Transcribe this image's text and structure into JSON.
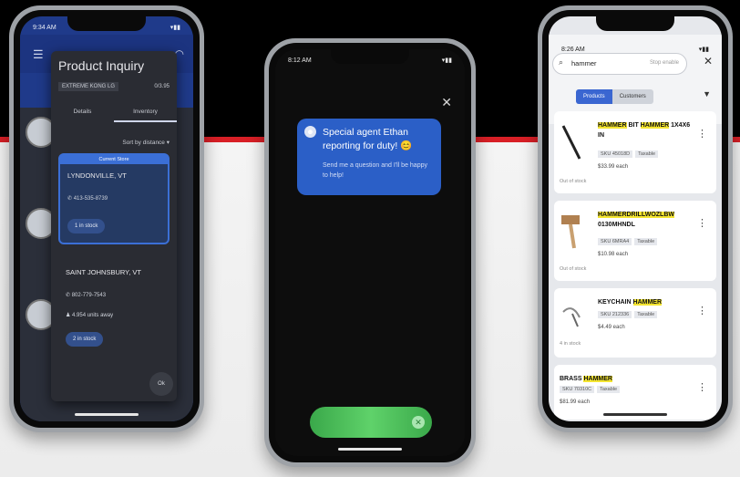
{
  "phone1": {
    "status_time": "9:34 AM",
    "title": "Product Inquiry",
    "sku": "EXTREME KONG LG",
    "count": "0/3.95",
    "tabs": [
      "Details",
      "Inventory"
    ],
    "sort_label": "Sort by distance",
    "current_label": "Current Store",
    "stores": [
      {
        "name": "LYNDONVILLE, VT",
        "phone": "413-535-8739",
        "stock": "1 in stock"
      },
      {
        "name": "SAINT JOHNSBURY, VT",
        "phone": "802-779-7543",
        "away": "4.954 units away",
        "stock": "2 in stock"
      }
    ],
    "ok_label": "Ok"
  },
  "phone2": {
    "status_time": "8:12 AM",
    "close_icon": "close-icon",
    "message": "Special agent Ethan reporting for duty! 😊",
    "submessage": "Send me a question and I'll be happy to help!"
  },
  "phone3": {
    "status_time": "8:26 AM",
    "search_value": "hammer",
    "search_hint": "Stop enable",
    "seg": [
      "Products",
      "Customers"
    ],
    "cards": [
      {
        "pre": "",
        "hl1": "HAMMER",
        "mid": " BIT ",
        "hl2": "HAMMER",
        "post": " 1X4X6 IN",
        "sku": "SKU 45018D",
        "tag": "Taxable",
        "price": "$33.99 each",
        "stock": "Out of stock"
      },
      {
        "pre": "",
        "hl1": "HAMMERDRILLWOZLBW",
        "mid": "",
        "hl2": "",
        "post": " 0130MHNDL",
        "sku": "SKU 6MRA4",
        "tag": "Taxable",
        "price": "$10.98 each",
        "stock": "Out of stock"
      },
      {
        "pre": "KEYCHAIN ",
        "hl1": "HAMMER",
        "mid": "",
        "hl2": "",
        "post": "",
        "sku": "SKU 212336",
        "tag": "Taxable",
        "price": "$4.49 each",
        "stock": "4 in stock"
      },
      {
        "pre": "BRASS ",
        "hl1": "HAMMER",
        "mid": "",
        "hl2": "",
        "post": "",
        "sku": "SKU 70310C",
        "tag": "Taxable",
        "price": "$81.99 each",
        "stock": ""
      }
    ]
  }
}
